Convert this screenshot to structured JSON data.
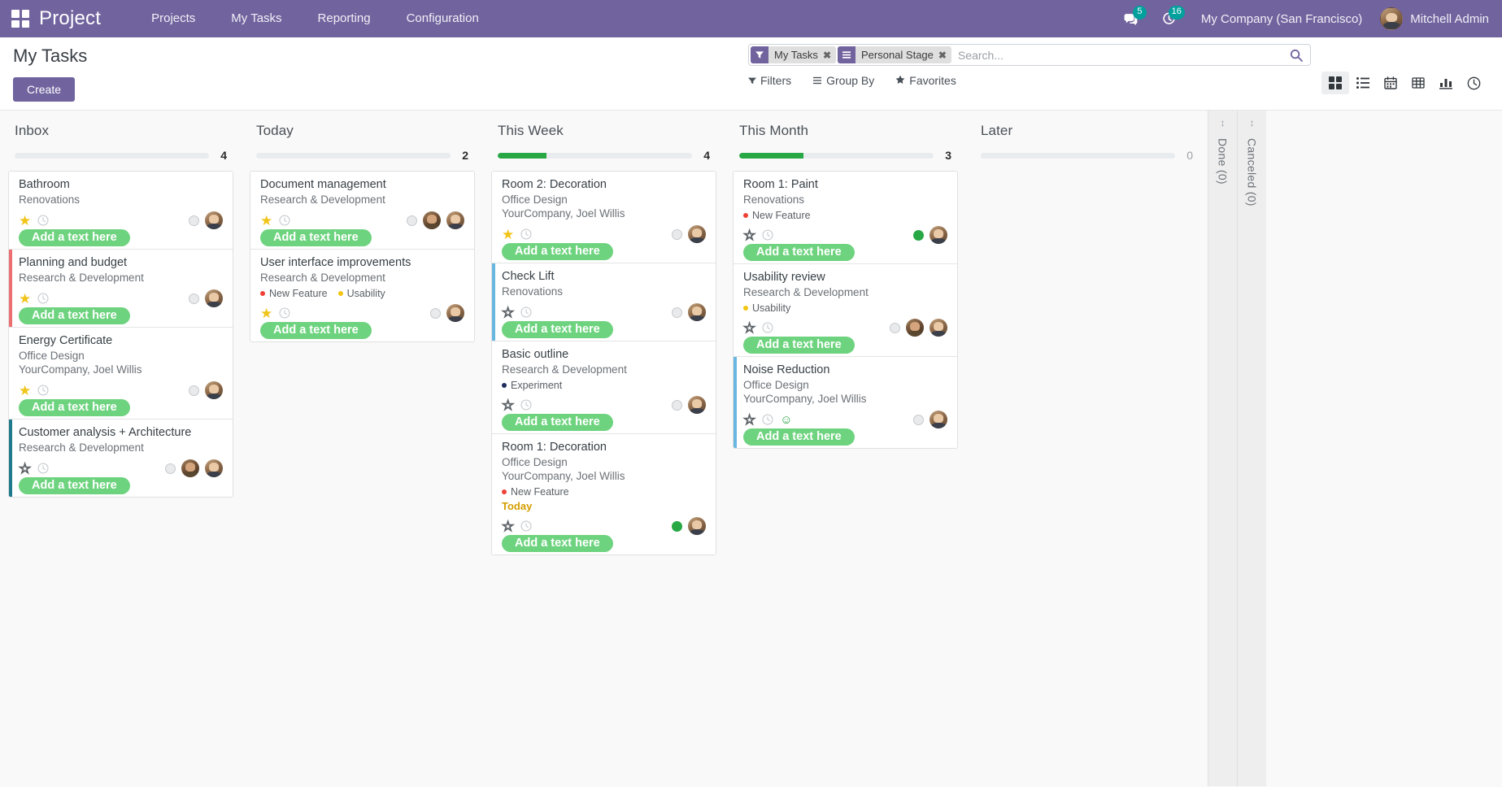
{
  "navbar": {
    "apps_icon": "apps-grid-icon",
    "brand": "Project",
    "menu": [
      "Projects",
      "My Tasks",
      "Reporting",
      "Configuration"
    ],
    "messages_icon": "chat-bubble-icon",
    "messages_count": "5",
    "activities_icon": "clock-activity-icon",
    "activities_count": "16",
    "company": "My Company (San Francisco)",
    "user": "Mitchell Admin",
    "bg_color": "#71639e"
  },
  "control_panel": {
    "title": "My Tasks",
    "create_label": "Create",
    "facets": [
      {
        "icon": "filter-funnel-icon",
        "label": "My Tasks",
        "remove": "✖"
      },
      {
        "icon": "group-by-bars-icon",
        "label": "Personal Stage",
        "remove": "✖"
      }
    ],
    "search_placeholder": "Search...",
    "search_value": "",
    "dropdowns": [
      {
        "icon": "filter-caret-icon",
        "label": "Filters"
      },
      {
        "icon": "group-by-lines-icon",
        "label": "Group By"
      },
      {
        "icon": "star-icon",
        "label": "Favorites"
      }
    ],
    "views": [
      {
        "name": "kanban-view-button",
        "icon": "kanban-grid-icon",
        "active": true
      },
      {
        "name": "list-view-button",
        "icon": "list-icon",
        "active": false
      },
      {
        "name": "calendar-view-button",
        "icon": "calendar-icon",
        "active": false
      },
      {
        "name": "pivot-view-button",
        "icon": "table-icon",
        "active": false
      },
      {
        "name": "graph-view-button",
        "icon": "bar-chart-icon",
        "active": false
      },
      {
        "name": "activity-view-button",
        "icon": "clock-icon",
        "active": false
      }
    ]
  },
  "columns": [
    {
      "title": "Inbox",
      "count": "4",
      "progress_pct": 0,
      "cards": [
        {
          "title": "Bathroom",
          "project": "Renovations",
          "customer": "",
          "tags": [],
          "date": "",
          "priority_star": "on",
          "left_border": "",
          "smiley": false,
          "status": "gray",
          "assignees": 1,
          "placeholder": "Add a text here"
        },
        {
          "title": "Planning and budget",
          "project": "Research & Development",
          "customer": "",
          "tags": [],
          "date": "",
          "priority_star": "on",
          "left_border": "#eb6f70",
          "smiley": false,
          "status": "gray",
          "assignees": 1,
          "placeholder": "Add a text here"
        },
        {
          "title": "Energy Certificate",
          "project": "Office Design",
          "customer": "YourCompany, Joel Willis",
          "tags": [],
          "date": "",
          "priority_star": "on",
          "left_border": "",
          "smiley": false,
          "status": "gray",
          "assignees": 1,
          "placeholder": "Add a text here"
        },
        {
          "title": "Customer analysis + Architecture",
          "project": "Research & Development",
          "customer": "",
          "tags": [],
          "date": "",
          "priority_star": "off",
          "left_border": "#1f7a8c",
          "smiley": false,
          "status": "gray",
          "assignees": 2,
          "placeholder": "Add a text here"
        }
      ]
    },
    {
      "title": "Today",
      "count": "2",
      "progress_pct": 0,
      "cards": [
        {
          "title": "Document management",
          "project": "Research & Development",
          "customer": "",
          "tags": [],
          "date": "",
          "priority_star": "on",
          "left_border": "",
          "smiley": false,
          "status": "gray",
          "assignees": 2,
          "placeholder": "Add a text here"
        },
        {
          "title": "User interface improvements",
          "project": "Research & Development",
          "customer": "",
          "tags": [
            {
              "label": "New Feature",
              "color": "#ef4135"
            },
            {
              "label": "Usability",
              "color": "#f2c511"
            }
          ],
          "date": "",
          "priority_star": "on",
          "left_border": "",
          "smiley": false,
          "status": "gray",
          "assignees": 1,
          "placeholder": "Add a text here"
        }
      ]
    },
    {
      "title": "This Week",
      "count": "4",
      "progress_pct": 25,
      "cards": [
        {
          "title": "Room 2: Decoration",
          "project": "Office Design",
          "customer": "YourCompany, Joel Willis",
          "tags": [],
          "date": "",
          "priority_star": "on",
          "left_border": "",
          "smiley": false,
          "status": "gray",
          "assignees": 1,
          "placeholder": "Add a text here"
        },
        {
          "title": "Check Lift",
          "project": "Renovations",
          "customer": "",
          "tags": [],
          "date": "",
          "priority_star": "off",
          "left_border": "#69b7e0",
          "smiley": false,
          "status": "gray",
          "assignees": 1,
          "placeholder": "Add a text here"
        },
        {
          "title": "Basic outline",
          "project": "Research & Development",
          "customer": "",
          "tags": [
            {
              "label": "Experiment",
              "color": "#1c2d5e"
            }
          ],
          "date": "",
          "priority_star": "off",
          "left_border": "",
          "smiley": false,
          "status": "gray",
          "assignees": 1,
          "placeholder": "Add a text here"
        },
        {
          "title": "Room 1: Decoration",
          "project": "Office Design",
          "customer": "YourCompany, Joel Willis",
          "tags": [
            {
              "label": "New Feature",
              "color": "#ef4135"
            }
          ],
          "date": "Today",
          "date_color": "#d39e00",
          "priority_star": "off",
          "left_border": "",
          "smiley": false,
          "status": "green",
          "assignees": 1,
          "placeholder": "Add a text here"
        }
      ]
    },
    {
      "title": "This Month",
      "count": "3",
      "progress_pct": 33,
      "cards": [
        {
          "title": "Room 1: Paint",
          "project": "Renovations",
          "customer": "",
          "tags": [
            {
              "label": "New Feature",
              "color": "#ef4135"
            }
          ],
          "date": "",
          "priority_star": "off",
          "left_border": "",
          "smiley": false,
          "status": "green",
          "assignees": 1,
          "placeholder": "Add a text here"
        },
        {
          "title": "Usability review",
          "project": "Research & Development",
          "customer": "",
          "tags": [
            {
              "label": "Usability",
              "color": "#f2c511"
            }
          ],
          "date": "",
          "priority_star": "off",
          "left_border": "",
          "smiley": false,
          "status": "gray",
          "assignees": 2,
          "placeholder": "Add a text here"
        },
        {
          "title": "Noise Reduction",
          "project": "Office Design",
          "customer": "YourCompany, Joel Willis",
          "tags": [],
          "date": "",
          "priority_star": "off",
          "left_border": "#69b7e0",
          "smiley": true,
          "status": "gray",
          "assignees": 1,
          "placeholder": "Add a text here"
        }
      ]
    },
    {
      "title": "Later",
      "count": "0",
      "progress_pct": 0,
      "cards": []
    }
  ],
  "folded_columns": [
    {
      "label": "Done (0)",
      "arrow": "↕"
    },
    {
      "label": "Canceled (0)",
      "arrow": "↕"
    }
  ]
}
